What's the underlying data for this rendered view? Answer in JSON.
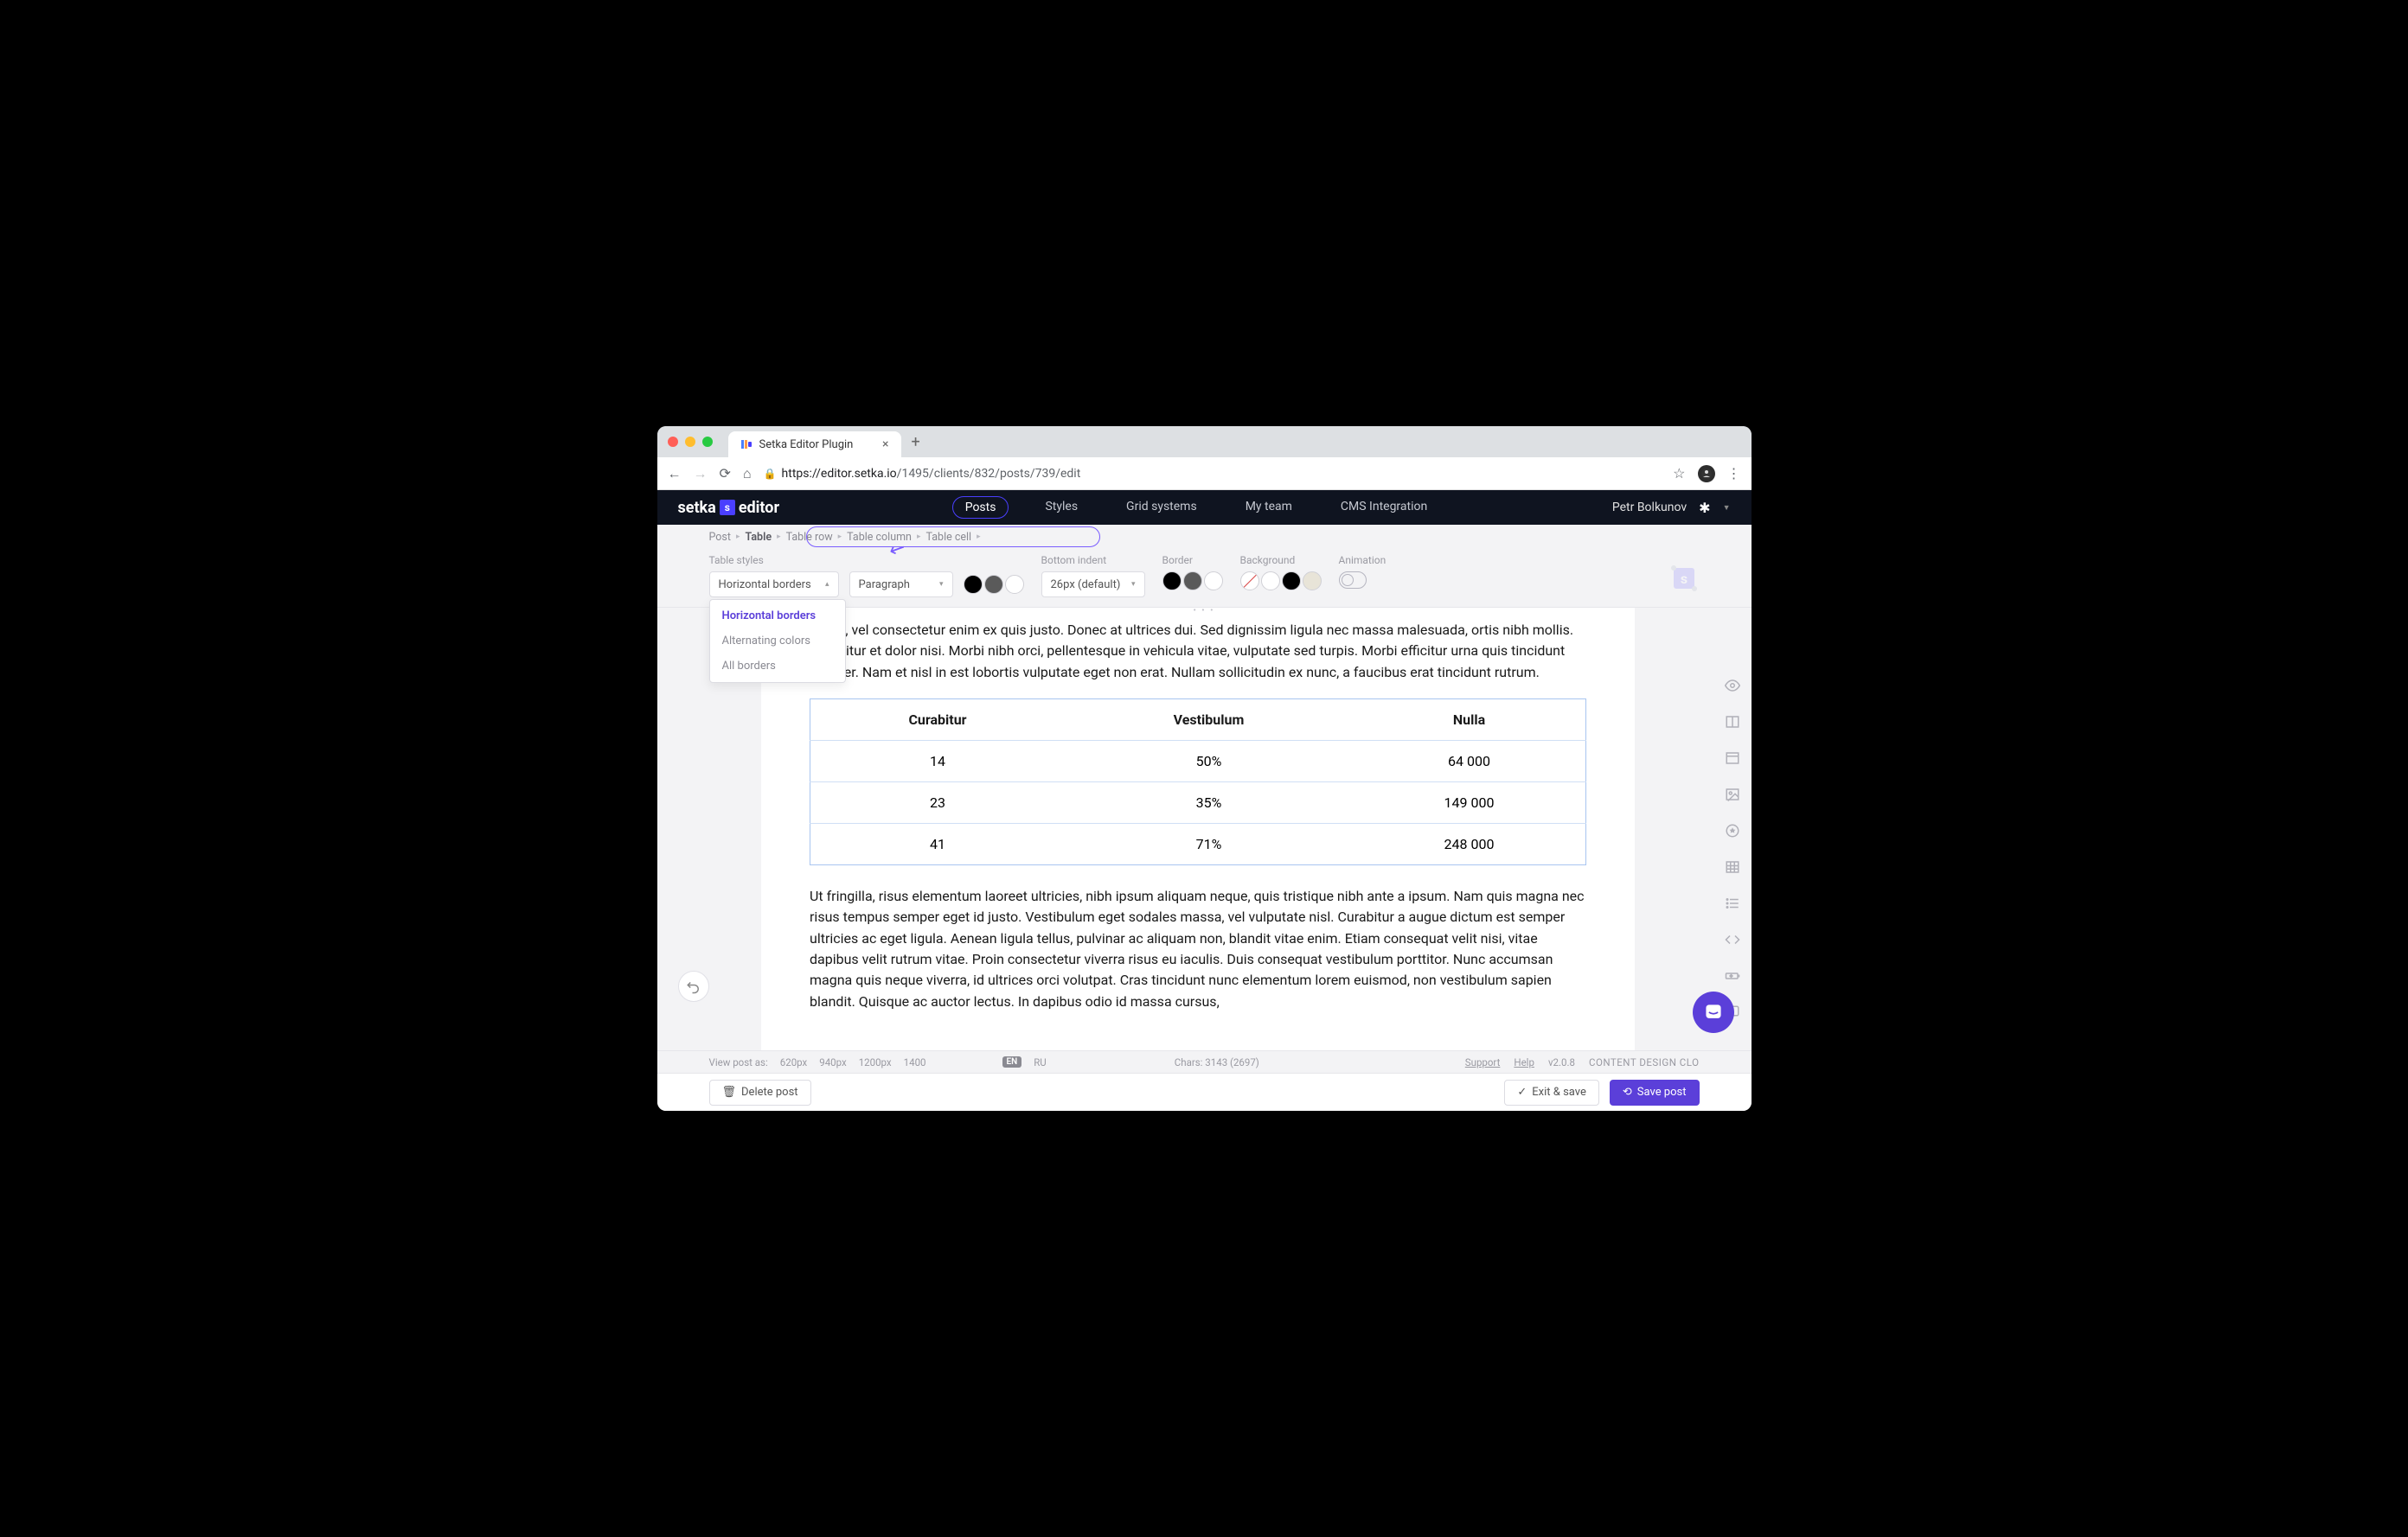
{
  "browser": {
    "tab_title": "Setka Editor Plugin",
    "url_domain": "https://editor.setka.io",
    "url_path": "/1495/clients/832/posts/739/edit"
  },
  "appbar": {
    "logo_left": "setka",
    "logo_right": "editor",
    "nav": [
      "Posts",
      "Styles",
      "Grid systems",
      "My team",
      "CMS Integration"
    ],
    "active_nav": "Posts",
    "user": "Petr Bolkunov"
  },
  "breadcrumb": [
    "Post",
    "Table",
    "Table row",
    "Table column",
    "Table cell"
  ],
  "toolbar": {
    "table_styles_label": "Table styles",
    "table_style_value": "Horizontal borders",
    "paragraph_value": "Paragraph",
    "bottom_indent_label": "Bottom indent",
    "bottom_indent_value": "26px (default)",
    "border_label": "Border",
    "background_label": "Background",
    "animation_label": "Animation",
    "dropdown_options": [
      "Horizontal borders",
      "Alternating colors",
      "All borders"
    ]
  },
  "content": {
    "para1": "s velit, vel consectetur enim ex quis justo. Donec at ultrices dui. Sed dignissim ligula nec massa malesuada, ortis nibh mollis. Curabitur et dolor nisi. Morbi nibh orci, pellentesque in vehicula vitae, vulputate sed turpis. Morbi efficitur urna quis tincidunt semper. Nam et nisl in est lobortis vulputate eget non erat. Nullam sollicitudin ex nunc, a faucibus erat tincidunt rutrum.",
    "table": {
      "headers": [
        "Curabitur",
        "Vestibulum",
        "Nulla"
      ],
      "rows": [
        [
          "14",
          "50%",
          "64 000"
        ],
        [
          "23",
          "35%",
          "149 000"
        ],
        [
          "41",
          "71%",
          "248 000"
        ]
      ]
    },
    "para2": "Ut fringilla, risus elementum laoreet ultricies, nibh ipsum aliquam neque, quis tristique nibh ante a ipsum. Nam quis magna nec risus tempus semper eget id justo. Vestibulum eget sodales massa, vel vulputate nisl. Curabitur a augue dictum est semper ultricies ac eget ligula. Aenean ligula tellus, pulvinar ac aliquam non, blandit vitae enim. Etiam consequat velit nisi, vitae dapibus velit rutrum vitae. Proin consectetur viverra risus eu iaculis. Duis consequat vestibulum porttitor. Nunc accumsan magna quis neque viverra, id ultrices orci volutpat. Cras tincidunt nunc elementum lorem euismod, non vestibulum sapien blandit. Quisque ac auctor lectus. In dapibus odio id massa cursus,"
  },
  "statusbar": {
    "view_label": "View post as:",
    "widths": [
      "620px",
      "940px",
      "1200px",
      "1400"
    ],
    "lang_active": "EN",
    "lang_inactive": "RU",
    "chars": "Chars: 3143 (2697)",
    "support": "Support",
    "help": "Help",
    "version": "v2.0.8",
    "brand": "CONTENT DESIGN CLO"
  },
  "bottombar": {
    "delete": "Delete post",
    "exit": "Exit & save",
    "save": "Save post"
  }
}
